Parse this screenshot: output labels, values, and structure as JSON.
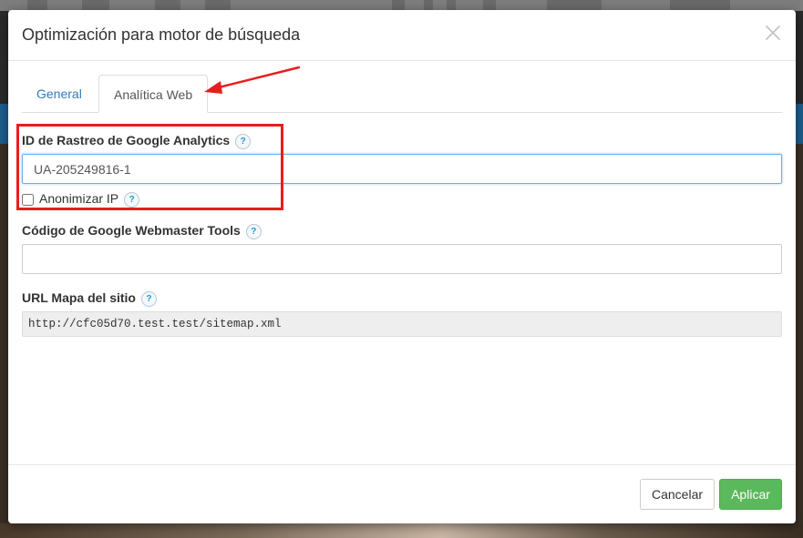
{
  "modal": {
    "title": "Optimización para motor de búsqueda",
    "tabs": [
      {
        "label": "General",
        "active": false
      },
      {
        "label": "Analítica Web",
        "active": true
      }
    ],
    "fields": {
      "ga_tracking": {
        "label": "ID de Rastreo de Google Analytics",
        "value": "UA-205249816-1"
      },
      "anonymize_ip": {
        "label": "Anonimizar IP",
        "checked": false
      },
      "webmaster": {
        "label": "Código de Google Webmaster Tools",
        "value": ""
      },
      "sitemap": {
        "label": "URL Mapa del sitio",
        "value": "http://cfc05d70.test.test/sitemap.xml"
      }
    },
    "help_glyph": "?",
    "footer": {
      "cancel_label": "Cancelar",
      "apply_label": "Aplicar"
    }
  },
  "colors": {
    "link": "#337ab7",
    "apply": "#5cb85c",
    "annotation": "#e81e1e",
    "help": "#1a9ad6"
  },
  "icons": [
    "close-icon",
    "help-icon",
    "annotation-arrow-icon"
  ]
}
